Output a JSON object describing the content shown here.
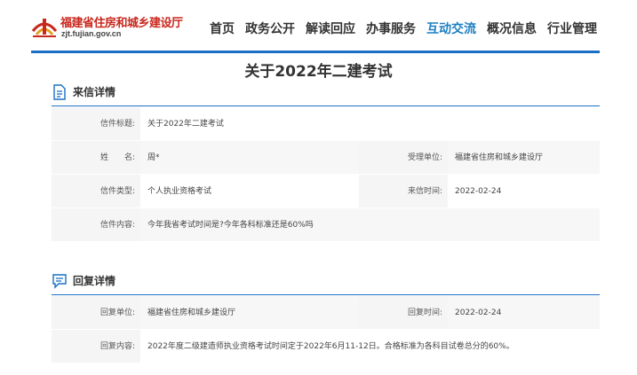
{
  "site": {
    "name": "福建省住房和城乡建设厅",
    "domain": "zjt.fujian.gov.cn",
    "brand_color": "#c8281e",
    "accent_color": "#1a6fc4"
  },
  "nav": {
    "items": [
      "首页",
      "政务公开",
      "解读回应",
      "办事服务",
      "互动交流",
      "概况信息",
      "行业管理"
    ],
    "active": "互动交流"
  },
  "page": {
    "title": "关于2022年二建考试"
  },
  "letter": {
    "section_title": "来信详情",
    "icon": "document-icon",
    "subject_label": "信件标题:",
    "subject_value": "关于2022年二建考试",
    "name_label": "姓　　名:",
    "name_value": "周*",
    "unit_label": "受理单位:",
    "unit_value": "福建省住房和城乡建设厅",
    "type_label": "信件类型:",
    "type_value": "个人执业资格考试",
    "date_label": "来信时间:",
    "date_value": "2022-02-24",
    "content_label": "信件内容:",
    "content_value": "今年我省考试时间是?今年各科标准还是60%吗"
  },
  "reply": {
    "section_title": "回复详情",
    "icon": "chat-icon",
    "unit_label": "回复单位:",
    "unit_value": "福建省住房和城乡建设厅",
    "date_label": "回复时间:",
    "date_value": "2022-02-24",
    "content_label": "回复内容:",
    "content_value": "2022年度二级建造师执业资格考试时间定于2022年6月11-12日。合格标准为各科目试卷总分的60%。"
  }
}
